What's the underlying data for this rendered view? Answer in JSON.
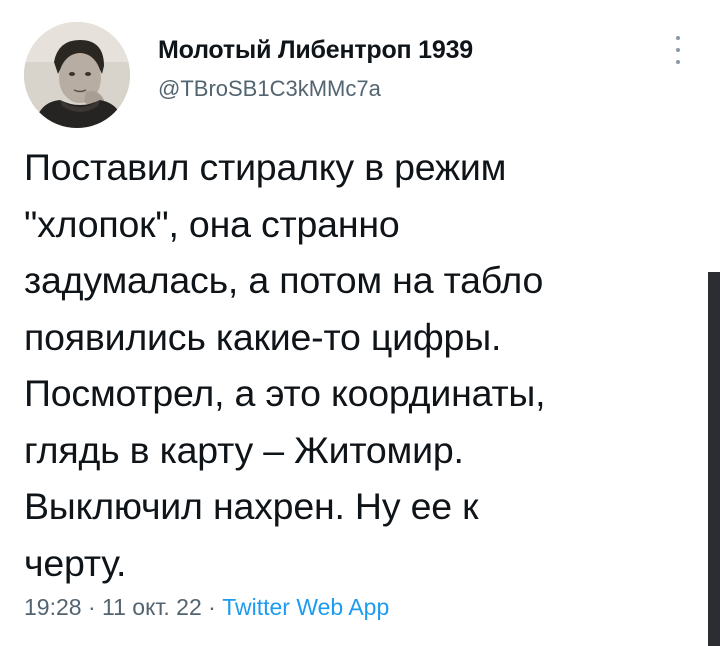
{
  "author": {
    "display_name": "Молотый Либентроп 1939",
    "handle": "@TBroSB1C3kMMc7a",
    "avatar_icon": "user-avatar-photo"
  },
  "tweet": {
    "text_lines": [
      "Поставил стиралку в режим",
      "\"хлопок\", она странно",
      "задумалась, а потом на табло",
      "появились какие-то цифры.",
      "Посмотрел, а это координаты,",
      "глядь в карту – Житомир.",
      "Выключил нахрен. Ну ее к",
      "черту."
    ],
    "time": "19:28",
    "separator": "·",
    "date": "11 окт. 22",
    "source": "Twitter Web App"
  },
  "more_icon": "more-vertical-icon",
  "colors": {
    "text": "#0f1419",
    "secondary": "#536471",
    "link": "#1d9bf0",
    "background": "#ffffff"
  }
}
